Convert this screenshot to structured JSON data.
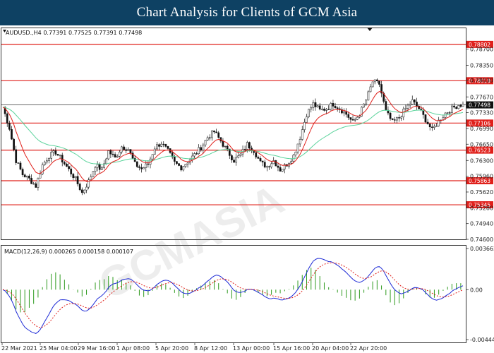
{
  "banner": {
    "title": "Chart Analysis for Clients of GCM Asia"
  },
  "chart_data": {
    "type": "candlestick",
    "symbol_header": "AUDUSD.,H4  0.77391  0.77525  0.77391  0.77498",
    "price_axis": {
      "min": 0.746,
      "max": 0.7915,
      "ticks": [
        "0.78700",
        "0.78350",
        "0.78030",
        "0.77670",
        "0.77330",
        "0.76990",
        "0.76650",
        "0.76300",
        "0.75960",
        "0.75620",
        "0.75280",
        "0.74940",
        "0.74600"
      ]
    },
    "current_price": "0.77498",
    "resistance_support_levels": [
      {
        "label": "0.78802",
        "value": 0.78802
      },
      {
        "label": "0.78019",
        "value": 0.78019
      },
      {
        "label": "0.77106",
        "value": 0.77106
      },
      {
        "label": "0.76523",
        "value": 0.76523
      },
      {
        "label": "0.75863",
        "value": 0.75863
      },
      {
        "label": "0.75345",
        "value": 0.75345
      }
    ],
    "level_color": "#e0201b",
    "fast_ma_color": "#e0201b",
    "slow_ma_color": "#5ad39b",
    "macd": {
      "label": "MACD(12,26,9)  0.000265  0.000158  0.000107",
      "min": -0.004443,
      "max": 0.003662,
      "ticks": [
        "0.003662",
        "0.00",
        "-0.004443"
      ],
      "macd_color": "#1e2bd6",
      "signal_color": "#e0201b",
      "histogram_color": "#2e9a1e"
    },
    "time_labels": [
      "22 Mar 2021",
      "25 Mar 04:00",
      "29 Mar 16:00",
      "1 Apr 08:00",
      "5 Apr 20:00",
      "8 Apr 12:00",
      "13 Apr 00:00",
      "15 Apr 16:00",
      "20 Apr 04:00",
      "22 Apr 20:00"
    ],
    "price_path": [
      [
        0,
        0.7745
      ],
      [
        3,
        0.77
      ],
      [
        6,
        0.763
      ],
      [
        9,
        0.76
      ],
      [
        12,
        0.759
      ],
      [
        15,
        0.7575
      ],
      [
        18,
        0.762
      ],
      [
        21,
        0.764
      ],
      [
        24,
        0.7648
      ],
      [
        27,
        0.763
      ],
      [
        30,
        0.761
      ],
      [
        33,
        0.759
      ],
      [
        36,
        0.756
      ],
      [
        39,
        0.7585
      ],
      [
        42,
        0.762
      ],
      [
        45,
        0.761
      ],
      [
        48,
        0.765
      ],
      [
        51,
        0.7635
      ],
      [
        54,
        0.766
      ],
      [
        57,
        0.7655
      ],
      [
        60,
        0.7622
      ],
      [
        63,
        0.7612
      ],
      [
        66,
        0.7622
      ],
      [
        69,
        0.7658
      ],
      [
        72,
        0.7668
      ],
      [
        75,
        0.765
      ],
      [
        78,
        0.7625
      ],
      [
        81,
        0.7615
      ],
      [
        84,
        0.7628
      ],
      [
        87,
        0.7642
      ],
      [
        90,
        0.7658
      ],
      [
        93,
        0.768
      ],
      [
        96,
        0.7692
      ],
      [
        99,
        0.7672
      ],
      [
        102,
        0.765
      ],
      [
        105,
        0.763
      ],
      [
        108,
        0.7642
      ],
      [
        111,
        0.7665
      ],
      [
        114,
        0.7652
      ],
      [
        117,
        0.7625
      ],
      [
        120,
        0.7617
      ],
      [
        123,
        0.763
      ],
      [
        126,
        0.761
      ],
      [
        129,
        0.7622
      ],
      [
        132,
        0.764
      ],
      [
        135,
        0.768
      ],
      [
        138,
        0.773
      ],
      [
        141,
        0.7752
      ],
      [
        144,
        0.7738
      ],
      [
        147,
        0.7742
      ],
      [
        150,
        0.7752
      ],
      [
        153,
        0.7742
      ],
      [
        156,
        0.773
      ],
      [
        159,
        0.7712
      ],
      [
        162,
        0.773
      ],
      [
        165,
        0.776
      ],
      [
        168,
        0.78
      ],
      [
        171,
        0.7795
      ],
      [
        174,
        0.7735
      ],
      [
        177,
        0.7712
      ],
      [
        180,
        0.7722
      ],
      [
        183,
        0.7742
      ],
      [
        186,
        0.7758
      ],
      [
        189,
        0.7742
      ],
      [
        192,
        0.7718
      ],
      [
        195,
        0.7695
      ],
      [
        198,
        0.7715
      ],
      [
        201,
        0.7732
      ],
      [
        204,
        0.7742
      ],
      [
        207,
        0.775
      ]
    ]
  }
}
